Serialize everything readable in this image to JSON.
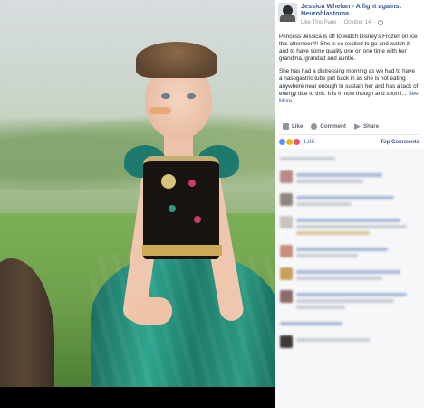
{
  "post": {
    "page_name": "Jessica Whelan - A fight against Neuroblastoma",
    "page_name_line1": "Jessica Whelan - A fight against",
    "page_name_line2": "Neuroblastoma",
    "liked_label": "Like This Page",
    "date": "October 14",
    "paragraph1": "Princess Jessica is off to watch Disney's Frozen on Ice this afternoon!!! She is so excited to go and watch it and to have some quality one on one time with her grandma, grandad and auntie.",
    "paragraph2": "She has had a distressing morning as we had to have a nasogastric tube put back in as she is not eating anywhere near enough to sustain her and has a lack of energy due to this. It is in now though and soon f...",
    "see_more": "See More"
  },
  "actions": {
    "like": "Like",
    "comment": "Comment",
    "share": "Share"
  },
  "reactions": {
    "count": "1.8K",
    "sort_label": "Top Comments",
    "colors": [
      "#5890ff",
      "#f0ba15",
      "#f25268"
    ]
  },
  "colors": {
    "link_blue": "#365899",
    "meta_gray": "#90949c",
    "comment_bg": "#f6f7f9",
    "dress_teal": "#1f7a6e",
    "bodice_black": "#171412"
  }
}
